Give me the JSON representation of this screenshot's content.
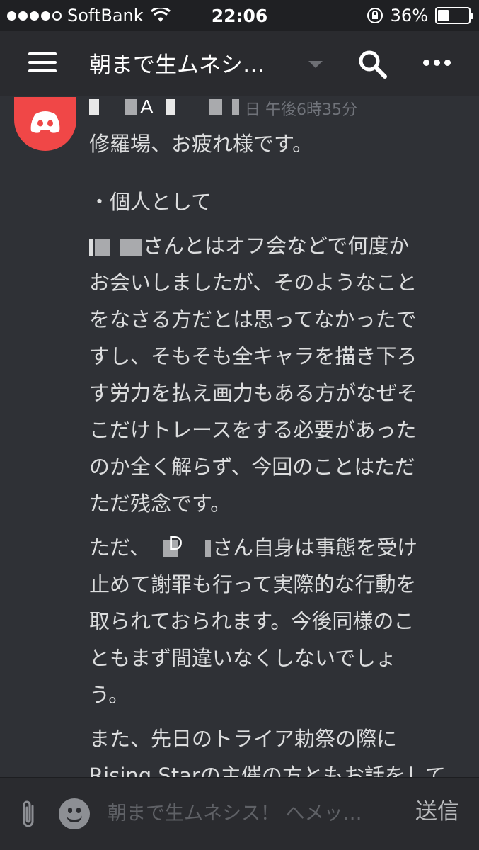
{
  "status_bar": {
    "carrier": "SoftBank",
    "time": "22:06",
    "battery_percent": "36%",
    "battery_level": 0.36
  },
  "header": {
    "channel_title": "朝まで生ムネシ…",
    "menu_icon": "hamburger-icon",
    "search_icon": "search-icon",
    "more_icon": "more-icon"
  },
  "message": {
    "author_label": "A",
    "timestamp": "日 午後6時35分",
    "lines": [
      "修羅場、お疲れ様です。",
      "・個人として",
      "さんとはオフ会などで何度か",
      "お会いしましたが、そのようなこと",
      "をなさる方だとは思ってなかったで",
      "すし、そもそも全キャラを描き下ろ",
      "す労力を払え画力もある方がなぜそ",
      "こだけトレースをする必要があった",
      "のか全く解らず、今回のことはただ",
      "ただ残念です。",
      "ただ、",
      "さん自身は事態を受け",
      "止めて謝罪も行って実際的な行動を",
      "取られておられます。今後同様のこ",
      "ともまず間違いなくしないでしょ",
      "う。",
      "また、先日のトライア勅祭の際に",
      "Rising Starの主催の方ともお話をして"
    ],
    "inline_label_d": "D"
  },
  "input_bar": {
    "placeholder": "朝まで生ムネシス！ へメッ…",
    "send_label": "送信",
    "attach_icon": "paperclip-icon",
    "emoji_icon": "emoji-icon"
  },
  "colors": {
    "background": "#2f3136",
    "discord_red": "#f04747",
    "text": "#dcddde"
  }
}
